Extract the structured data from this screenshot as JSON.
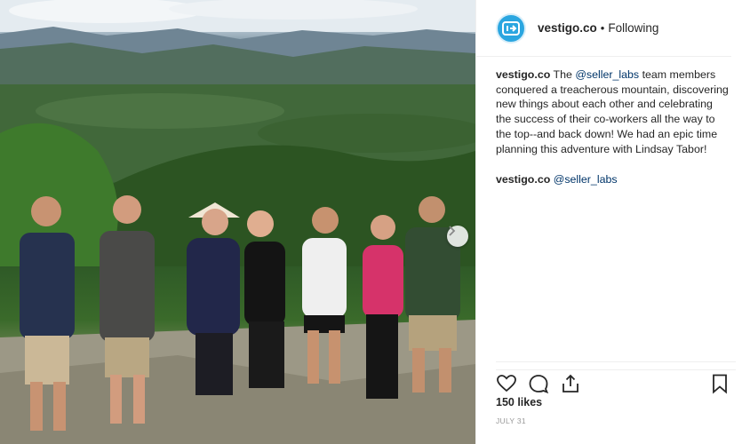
{
  "post": {
    "username": "vestigo.co",
    "separator": "•",
    "follow_status": "Following",
    "caption": {
      "username": "vestigo.co",
      "text_before": "The ",
      "mention": "@seller_labs",
      "text_after": " team members conquered a treacherous mountain, discovering new things about each other and celebrating the success of their co-workers all the way to the top--and back down! We had an epic time planning this adventure with Lindsay Tabor!"
    },
    "comment": {
      "username": "vestigo.co",
      "mention": "@seller_labs"
    },
    "likes": "150 likes",
    "date": "JULY 31"
  },
  "icons": {
    "avatar": "vestigo-logo-icon",
    "next": "chevron-right-icon",
    "like": "heart-icon",
    "comment": "comment-bubble-icon",
    "share": "share-icon",
    "save": "bookmark-icon"
  },
  "colors": {
    "accent": "#2ba6e0",
    "mention": "#003569",
    "text": "#262626",
    "muted": "#999999"
  }
}
